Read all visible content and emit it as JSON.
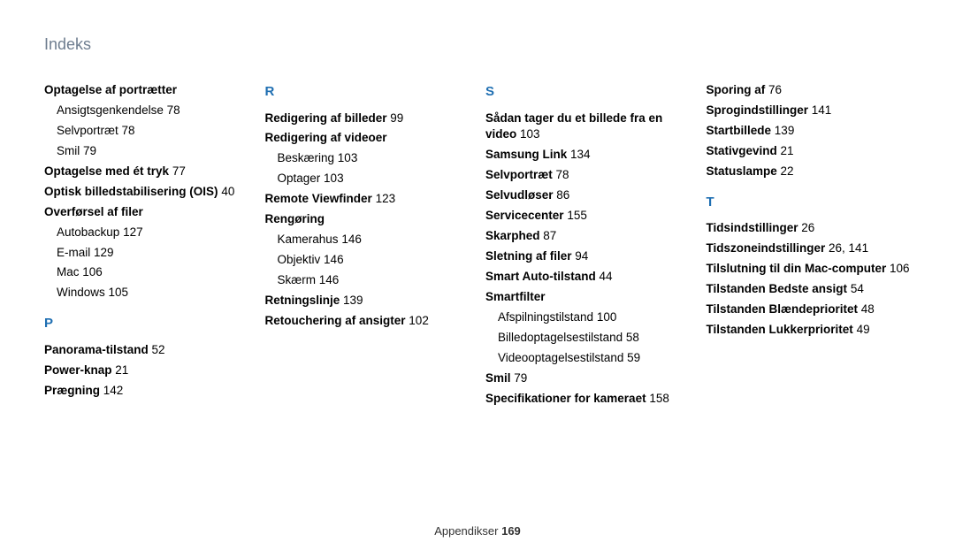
{
  "header": {
    "title": "Indeks"
  },
  "footer": {
    "section": "Appendikser",
    "page": "169"
  },
  "col1": {
    "e0": {
      "t": "Optagelse af portrætter"
    },
    "e0s0": {
      "t": "Ansigtsgenkendelse",
      "p": "78"
    },
    "e0s1": {
      "t": "Selvportræt",
      "p": "78"
    },
    "e0s2": {
      "t": "Smil",
      "p": "79"
    },
    "e1": {
      "t": "Optagelse med ét tryk",
      "p": "77"
    },
    "e2": {
      "t": "Optisk billedstabilisering (OIS)",
      "p": "40"
    },
    "e3": {
      "t": "Overførsel af filer"
    },
    "e3s0": {
      "t": "Autobackup",
      "p": "127"
    },
    "e3s1": {
      "t": "E-mail",
      "p": "129"
    },
    "e3s2": {
      "t": "Mac",
      "p": "106"
    },
    "e3s3": {
      "t": "Windows",
      "p": "105"
    },
    "lP": "P",
    "p0": {
      "t": "Panorama-tilstand",
      "p": "52"
    },
    "p1": {
      "t": "Power-knap",
      "p": "21"
    },
    "p2": {
      "t": "Prægning",
      "p": "142"
    }
  },
  "col2": {
    "lR": "R",
    "r0": {
      "t": "Redigering af billeder",
      "p": "99"
    },
    "r1": {
      "t": "Redigering af videoer"
    },
    "r1s0": {
      "t": "Beskæring",
      "p": "103"
    },
    "r1s1": {
      "t": "Optager",
      "p": "103"
    },
    "r2": {
      "t": "Remote Viewfinder",
      "p": "123"
    },
    "r3": {
      "t": "Rengøring"
    },
    "r3s0": {
      "t": "Kamerahus",
      "p": "146"
    },
    "r3s1": {
      "t": "Objektiv",
      "p": "146"
    },
    "r3s2": {
      "t": "Skærm",
      "p": "146"
    },
    "r4": {
      "t": "Retningslinje",
      "p": "139"
    },
    "r5": {
      "t": "Retouchering af ansigter",
      "p": "102"
    }
  },
  "col3": {
    "lS": "S",
    "s0a": {
      "t": "Sådan tager du et billede fra en"
    },
    "s0b": {
      "t": "video",
      "p": "103"
    },
    "s1": {
      "t": "Samsung Link",
      "p": "134"
    },
    "s2": {
      "t": "Selvportræt",
      "p": "78"
    },
    "s3": {
      "t": "Selvudløser",
      "p": "86"
    },
    "s4": {
      "t": "Servicecenter",
      "p": "155"
    },
    "s5": {
      "t": "Skarphed",
      "p": "87"
    },
    "s6": {
      "t": "Sletning af filer",
      "p": "94"
    },
    "s7": {
      "t": "Smart Auto-tilstand",
      "p": "44"
    },
    "s8": {
      "t": "Smartfilter"
    },
    "s8s0": {
      "t": "Afspilningstilstand",
      "p": "100"
    },
    "s8s1": {
      "t": "Billedoptagelsestilstand",
      "p": "58"
    },
    "s8s2": {
      "t": "Videooptagelsestilstand",
      "p": "59"
    },
    "s9": {
      "t": "Smil",
      "p": "79"
    },
    "s10": {
      "t": "Specifikationer for kameraet",
      "p": "158"
    }
  },
  "col4": {
    "a0": {
      "t": "Sporing af",
      "p": "76"
    },
    "a1": {
      "t": "Sprogindstillinger",
      "p": "141"
    },
    "a2": {
      "t": "Startbillede",
      "p": "139"
    },
    "a3": {
      "t": "Stativgevind",
      "p": "21"
    },
    "a4": {
      "t": "Statuslampe",
      "p": "22"
    },
    "lT": "T",
    "t0": {
      "t": "Tidsindstillinger",
      "p": "26"
    },
    "t1": {
      "t": "Tidszoneindstillinger",
      "p": "26, 141"
    },
    "t2": {
      "t": "Tilslutning til din Mac-computer",
      "p": "106"
    },
    "t3": {
      "t": "Tilstanden Bedste ansigt",
      "p": "54"
    },
    "t4": {
      "t": "Tilstanden Blændeprioritet",
      "p": "48"
    },
    "t5": {
      "t": "Tilstanden Lukkerprioritet",
      "p": "49"
    }
  }
}
